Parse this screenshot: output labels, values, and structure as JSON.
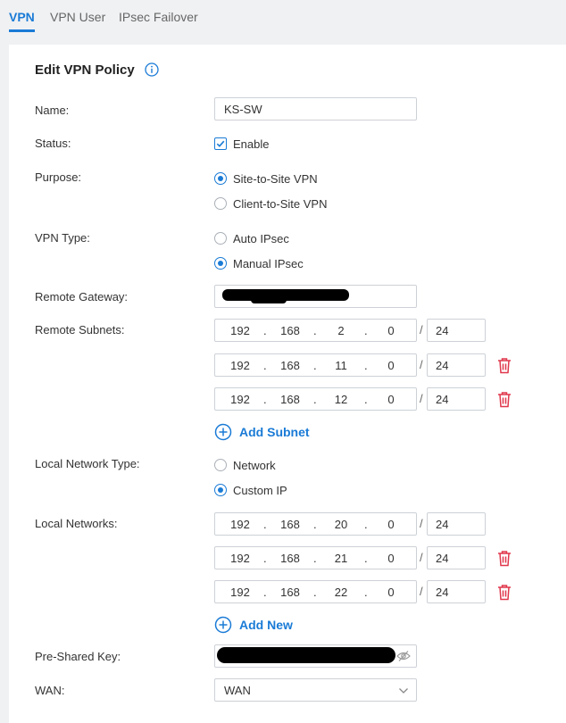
{
  "tabs": [
    {
      "label": "VPN",
      "active": true
    },
    {
      "label": "VPN User",
      "active": false
    },
    {
      "label": "IPsec Failover",
      "active": false
    }
  ],
  "form": {
    "title": "Edit VPN Policy",
    "name": {
      "label": "Name:",
      "value": "KS-SW"
    },
    "status": {
      "label": "Status:",
      "checkbox_label": "Enable",
      "checked": true
    },
    "purpose": {
      "label": "Purpose:",
      "options": [
        "Site-to-Site VPN",
        "Client-to-Site VPN"
      ],
      "selected": "Site-to-Site VPN"
    },
    "vpn_type": {
      "label": "VPN Type:",
      "options": [
        "Auto IPsec",
        "Manual IPsec"
      ],
      "selected": "Manual IPsec"
    },
    "remote_gateway": {
      "label": "Remote Gateway:",
      "value_redacted": true
    },
    "remote_subnets": {
      "label": "Remote Subnets:",
      "rows": [
        {
          "octets": [
            "192",
            "168",
            "2",
            "0"
          ],
          "mask": "24",
          "deletable": false
        },
        {
          "octets": [
            "192",
            "168",
            "11",
            "0"
          ],
          "mask": "24",
          "deletable": true
        },
        {
          "octets": [
            "192",
            "168",
            "12",
            "0"
          ],
          "mask": "24",
          "deletable": true
        }
      ],
      "add_label": "Add Subnet"
    },
    "local_network_type": {
      "label": "Local Network Type:",
      "options": [
        "Network",
        "Custom IP"
      ],
      "selected": "Custom IP"
    },
    "local_networks": {
      "label": "Local Networks:",
      "rows": [
        {
          "octets": [
            "192",
            "168",
            "20",
            "0"
          ],
          "mask": "24",
          "deletable": false
        },
        {
          "octets": [
            "192",
            "168",
            "21",
            "0"
          ],
          "mask": "24",
          "deletable": true
        },
        {
          "octets": [
            "192",
            "168",
            "22",
            "0"
          ],
          "mask": "24",
          "deletable": true
        }
      ],
      "add_label": "Add New"
    },
    "pre_shared_key": {
      "label": "Pre-Shared Key:",
      "value_redacted": true
    },
    "wan": {
      "label": "WAN:",
      "value": "WAN"
    }
  },
  "colors": {
    "accent": "#1a7bd6",
    "danger": "#e0374b",
    "background": "#f0f1f3"
  },
  "icons": {
    "info": "info-icon",
    "delete": "trash-icon",
    "add": "plus-circle-icon",
    "hide": "eye-slash-icon",
    "dropdown": "chevron-down-icon",
    "check": "check-icon"
  }
}
